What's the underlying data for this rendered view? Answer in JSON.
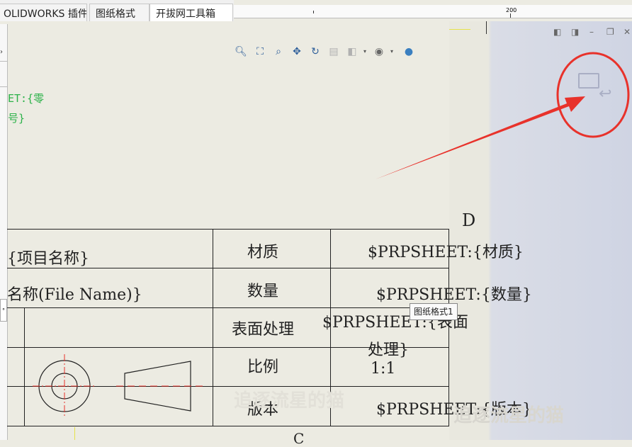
{
  "tabs": [
    {
      "label": "OLIDWORKS 插件"
    },
    {
      "label": "图纸格式"
    },
    {
      "label": "开拔网工具箱"
    }
  ],
  "ruler": {
    "mark": "200"
  },
  "sheet": {
    "green_line_1": "ET:{零",
    "green_line_2": "号}",
    "zone_label": "D",
    "bottom_label": "C"
  },
  "toolbar": {
    "icons": [
      "zoom-to-fit-icon",
      "zoom-area-icon",
      "zoom-in-out-icon",
      "pan-icon",
      "rotate-icon",
      "section-view-icon",
      "display-style-icon",
      "hide-show-icon",
      "appearance-icon"
    ]
  },
  "title_block": {
    "rows": [
      {
        "left": "{项目名称}",
        "label": "材质",
        "value": "$PRPSHEET:{材质}"
      },
      {
        "left": "名称(File Name)}",
        "label": "数量",
        "value": "$PRPSHEET:{数量}"
      },
      {
        "left": "",
        "label": "表面处理",
        "value": "$PRPSHEET:{表面",
        "value2": "处理}"
      },
      {
        "left": "",
        "label": "比例",
        "value": "1:1"
      },
      {
        "left": "",
        "label": "版本",
        "value": "$PRPSHEET:{版本}"
      }
    ]
  },
  "tooltip": "图纸格式1",
  "watermark": "追逐流星的猫",
  "colors": {
    "annotation_red": "#e8322b",
    "green_text": "#2db24a",
    "sheet_bg": "#ecebe2"
  }
}
